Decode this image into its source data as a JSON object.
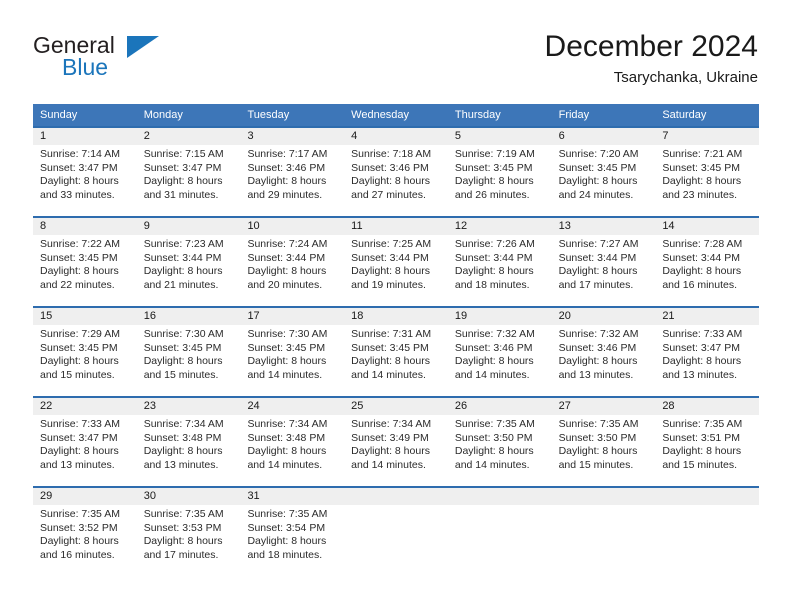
{
  "brand": {
    "name_part1": "General",
    "name_part2": "Blue",
    "triangle_color": "#1b75bb"
  },
  "header": {
    "title": "December 2024",
    "location": "Tsarychanka, Ukraine"
  },
  "calendar": {
    "header_bg": "#3d76b8",
    "daynames": [
      "Sunday",
      "Monday",
      "Tuesday",
      "Wednesday",
      "Thursday",
      "Friday",
      "Saturday"
    ],
    "weeks": [
      [
        {
          "day": "1",
          "sunrise": "Sunrise: 7:14 AM",
          "sunset": "Sunset: 3:47 PM",
          "daylight1": "Daylight: 8 hours",
          "daylight2": "and 33 minutes."
        },
        {
          "day": "2",
          "sunrise": "Sunrise: 7:15 AM",
          "sunset": "Sunset: 3:47 PM",
          "daylight1": "Daylight: 8 hours",
          "daylight2": "and 31 minutes."
        },
        {
          "day": "3",
          "sunrise": "Sunrise: 7:17 AM",
          "sunset": "Sunset: 3:46 PM",
          "daylight1": "Daylight: 8 hours",
          "daylight2": "and 29 minutes."
        },
        {
          "day": "4",
          "sunrise": "Sunrise: 7:18 AM",
          "sunset": "Sunset: 3:46 PM",
          "daylight1": "Daylight: 8 hours",
          "daylight2": "and 27 minutes."
        },
        {
          "day": "5",
          "sunrise": "Sunrise: 7:19 AM",
          "sunset": "Sunset: 3:45 PM",
          "daylight1": "Daylight: 8 hours",
          "daylight2": "and 26 minutes."
        },
        {
          "day": "6",
          "sunrise": "Sunrise: 7:20 AM",
          "sunset": "Sunset: 3:45 PM",
          "daylight1": "Daylight: 8 hours",
          "daylight2": "and 24 minutes."
        },
        {
          "day": "7",
          "sunrise": "Sunrise: 7:21 AM",
          "sunset": "Sunset: 3:45 PM",
          "daylight1": "Daylight: 8 hours",
          "daylight2": "and 23 minutes."
        }
      ],
      [
        {
          "day": "8",
          "sunrise": "Sunrise: 7:22 AM",
          "sunset": "Sunset: 3:45 PM",
          "daylight1": "Daylight: 8 hours",
          "daylight2": "and 22 minutes."
        },
        {
          "day": "9",
          "sunrise": "Sunrise: 7:23 AM",
          "sunset": "Sunset: 3:44 PM",
          "daylight1": "Daylight: 8 hours",
          "daylight2": "and 21 minutes."
        },
        {
          "day": "10",
          "sunrise": "Sunrise: 7:24 AM",
          "sunset": "Sunset: 3:44 PM",
          "daylight1": "Daylight: 8 hours",
          "daylight2": "and 20 minutes."
        },
        {
          "day": "11",
          "sunrise": "Sunrise: 7:25 AM",
          "sunset": "Sunset: 3:44 PM",
          "daylight1": "Daylight: 8 hours",
          "daylight2": "and 19 minutes."
        },
        {
          "day": "12",
          "sunrise": "Sunrise: 7:26 AM",
          "sunset": "Sunset: 3:44 PM",
          "daylight1": "Daylight: 8 hours",
          "daylight2": "and 18 minutes."
        },
        {
          "day": "13",
          "sunrise": "Sunrise: 7:27 AM",
          "sunset": "Sunset: 3:44 PM",
          "daylight1": "Daylight: 8 hours",
          "daylight2": "and 17 minutes."
        },
        {
          "day": "14",
          "sunrise": "Sunrise: 7:28 AM",
          "sunset": "Sunset: 3:44 PM",
          "daylight1": "Daylight: 8 hours",
          "daylight2": "and 16 minutes."
        }
      ],
      [
        {
          "day": "15",
          "sunrise": "Sunrise: 7:29 AM",
          "sunset": "Sunset: 3:45 PM",
          "daylight1": "Daylight: 8 hours",
          "daylight2": "and 15 minutes."
        },
        {
          "day": "16",
          "sunrise": "Sunrise: 7:30 AM",
          "sunset": "Sunset: 3:45 PM",
          "daylight1": "Daylight: 8 hours",
          "daylight2": "and 15 minutes."
        },
        {
          "day": "17",
          "sunrise": "Sunrise: 7:30 AM",
          "sunset": "Sunset: 3:45 PM",
          "daylight1": "Daylight: 8 hours",
          "daylight2": "and 14 minutes."
        },
        {
          "day": "18",
          "sunrise": "Sunrise: 7:31 AM",
          "sunset": "Sunset: 3:45 PM",
          "daylight1": "Daylight: 8 hours",
          "daylight2": "and 14 minutes."
        },
        {
          "day": "19",
          "sunrise": "Sunrise: 7:32 AM",
          "sunset": "Sunset: 3:46 PM",
          "daylight1": "Daylight: 8 hours",
          "daylight2": "and 14 minutes."
        },
        {
          "day": "20",
          "sunrise": "Sunrise: 7:32 AM",
          "sunset": "Sunset: 3:46 PM",
          "daylight1": "Daylight: 8 hours",
          "daylight2": "and 13 minutes."
        },
        {
          "day": "21",
          "sunrise": "Sunrise: 7:33 AM",
          "sunset": "Sunset: 3:47 PM",
          "daylight1": "Daylight: 8 hours",
          "daylight2": "and 13 minutes."
        }
      ],
      [
        {
          "day": "22",
          "sunrise": "Sunrise: 7:33 AM",
          "sunset": "Sunset: 3:47 PM",
          "daylight1": "Daylight: 8 hours",
          "daylight2": "and 13 minutes."
        },
        {
          "day": "23",
          "sunrise": "Sunrise: 7:34 AM",
          "sunset": "Sunset: 3:48 PM",
          "daylight1": "Daylight: 8 hours",
          "daylight2": "and 13 minutes."
        },
        {
          "day": "24",
          "sunrise": "Sunrise: 7:34 AM",
          "sunset": "Sunset: 3:48 PM",
          "daylight1": "Daylight: 8 hours",
          "daylight2": "and 14 minutes."
        },
        {
          "day": "25",
          "sunrise": "Sunrise: 7:34 AM",
          "sunset": "Sunset: 3:49 PM",
          "daylight1": "Daylight: 8 hours",
          "daylight2": "and 14 minutes."
        },
        {
          "day": "26",
          "sunrise": "Sunrise: 7:35 AM",
          "sunset": "Sunset: 3:50 PM",
          "daylight1": "Daylight: 8 hours",
          "daylight2": "and 14 minutes."
        },
        {
          "day": "27",
          "sunrise": "Sunrise: 7:35 AM",
          "sunset": "Sunset: 3:50 PM",
          "daylight1": "Daylight: 8 hours",
          "daylight2": "and 15 minutes."
        },
        {
          "day": "28",
          "sunrise": "Sunrise: 7:35 AM",
          "sunset": "Sunset: 3:51 PM",
          "daylight1": "Daylight: 8 hours",
          "daylight2": "and 15 minutes."
        }
      ],
      [
        {
          "day": "29",
          "sunrise": "Sunrise: 7:35 AM",
          "sunset": "Sunset: 3:52 PM",
          "daylight1": "Daylight: 8 hours",
          "daylight2": "and 16 minutes."
        },
        {
          "day": "30",
          "sunrise": "Sunrise: 7:35 AM",
          "sunset": "Sunset: 3:53 PM",
          "daylight1": "Daylight: 8 hours",
          "daylight2": "and 17 minutes."
        },
        {
          "day": "31",
          "sunrise": "Sunrise: 7:35 AM",
          "sunset": "Sunset: 3:54 PM",
          "daylight1": "Daylight: 8 hours",
          "daylight2": "and 18 minutes."
        },
        {
          "day": "",
          "sunrise": "",
          "sunset": "",
          "daylight1": "",
          "daylight2": ""
        },
        {
          "day": "",
          "sunrise": "",
          "sunset": "",
          "daylight1": "",
          "daylight2": ""
        },
        {
          "day": "",
          "sunrise": "",
          "sunset": "",
          "daylight1": "",
          "daylight2": ""
        },
        {
          "day": "",
          "sunrise": "",
          "sunset": "",
          "daylight1": "",
          "daylight2": ""
        }
      ]
    ]
  }
}
